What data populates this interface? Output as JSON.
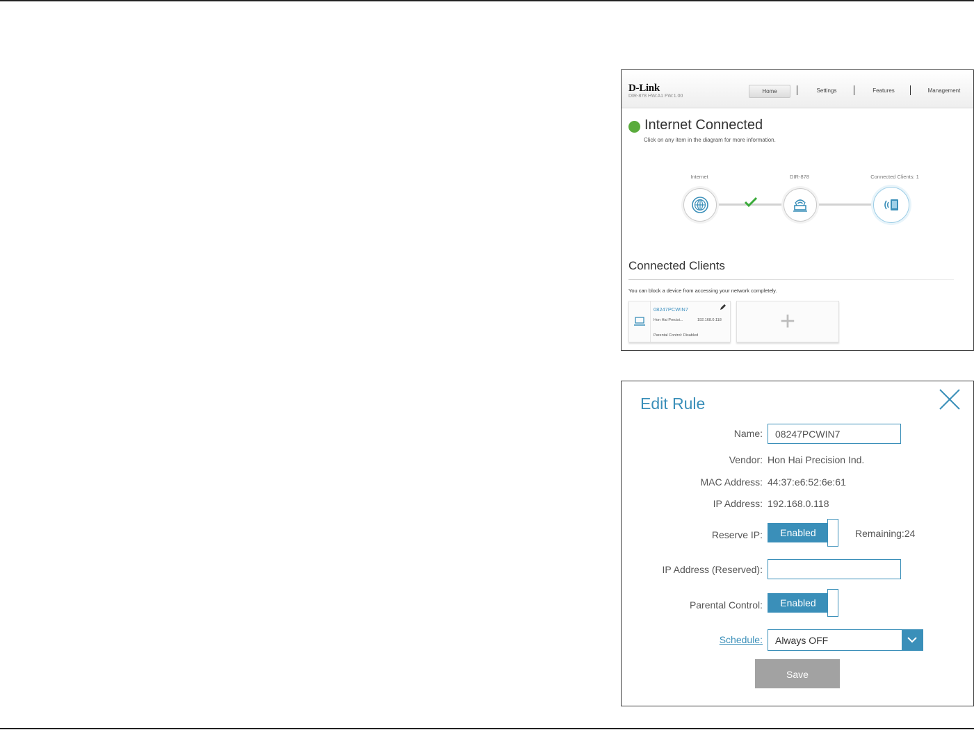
{
  "home": {
    "brand": "D-Link",
    "firmware": "DIR-878 HW:A1 FW:1.00",
    "nav": [
      "Home",
      "Settings",
      "Features",
      "Management"
    ],
    "status_title": "Internet Connected",
    "hint": "Click on any item in the diagram for more information.",
    "diagram": {
      "internet_label": "Internet",
      "router_label": "DIR-878",
      "clients_label": "Connected Clients: 1",
      "icons": [
        "globe-icon",
        "router-icon",
        "wireless-device-icon",
        "checkmark-icon"
      ],
      "link_status_color": "#3aab3a"
    },
    "clients_title": "Connected Clients",
    "clients_hint": "You can block a device from accessing your network completely.",
    "client": {
      "name": "08247PCWIN7",
      "vendor": "Hon Hai Precisi...",
      "ip": "192.168.0.118",
      "parental": "Parental Control: Disabled"
    },
    "add_client_symbol": "+"
  },
  "edit_rule": {
    "title": "Edit Rule",
    "labels": {
      "name": "Name:",
      "vendor": "Vendor:",
      "mac": "MAC Address:",
      "ip": "IP Address:",
      "reserve": "Reserve IP:",
      "ip_reserved": "IP Address (Reserved):",
      "parental": "Parental Control:",
      "schedule": "Schedule:"
    },
    "values": {
      "name": "08247PCWIN7",
      "vendor": "Hon Hai Precision Ind.",
      "mac": "44:37:e6:52:6e:61",
      "ip": "192.168.0.118",
      "reserve_state": "Enabled",
      "remaining": "Remaining:24",
      "ip_reserved": "",
      "parental_state": "Enabled",
      "schedule": "Always OFF"
    },
    "save_label": "Save",
    "accent_color": "#3a8fb9",
    "save_color": "#a2a2a2"
  }
}
